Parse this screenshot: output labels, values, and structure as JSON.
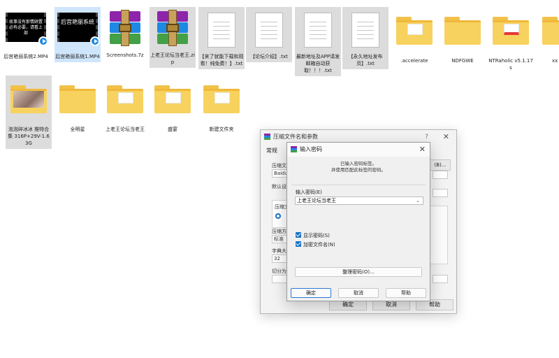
{
  "files": [
    {
      "label": "后宫艳丽系统2.MP4",
      "kind": "video",
      "thumb_text": "故事没有那情顾置\n必有必要，请看上部"
    },
    {
      "label": "后宫艳丽系统1.MP4",
      "kind": "video",
      "thumb_text": "后宫艳丽系统"
    },
    {
      "label": "Screenshots.7z",
      "kind": "rar"
    },
    {
      "label": "上老王论坛当老王.zip",
      "kind": "rar"
    },
    {
      "label": "【来了就能下载和观看！纯免费！】.txt",
      "kind": "doc"
    },
    {
      "label": "【论坛介绍】.txt",
      "kind": "doc"
    },
    {
      "label": "最新地址及APP请发邮箱自动获取！！！.txt",
      "kind": "doc"
    },
    {
      "label": "【永久地址发布页】.txt",
      "kind": "doc"
    },
    {
      "label": ".accelerate",
      "kind": "folder-paper"
    },
    {
      "label": "NDFGWE",
      "kind": "folder"
    },
    {
      "label": "NTRaholic v5.1.17s",
      "kind": "folder-red"
    },
    {
      "label": "xx",
      "kind": "folder"
    },
    {
      "label": "泡泡碎冰冰 推特合集 316P+29V-1.63G",
      "kind": "folder-photo"
    },
    {
      "label": "全明星",
      "kind": "folder"
    },
    {
      "label": "上老王论坛当老王",
      "kind": "folder-paper"
    },
    {
      "label": "盛宴",
      "kind": "folder-paper"
    },
    {
      "label": "新建文件夹",
      "kind": "folder-paper"
    }
  ],
  "archive_dialog": {
    "title": "压缩文件名和参数",
    "help_glyph": "?",
    "close_glyph": "✕",
    "tab_general": "常规",
    "label_archive_name": "压缩文",
    "field_archive_name": "BaiduN",
    "browse_fragment": "(B)...",
    "label_default": "默认设",
    "label_format": "压缩文",
    "label_method": "压缩方",
    "field_method": "标准",
    "label_dict": "字典大",
    "field_dict": "32",
    "label_split": "切分为",
    "ok_label": "确定",
    "cancel_label": "取消",
    "help_label": "帮助"
  },
  "password_dialog": {
    "title": "输入密码",
    "close_glyph": "✕",
    "info_line1": "已输入密码标签。",
    "info_line2": "并使用匹配此标签的密码。",
    "password_label": "输入密码(E)",
    "password_value": "上老王论坛当老王",
    "dropdown_glyph": "⌄",
    "show_password_label": "显示密码(S)",
    "encrypt_filenames_label": "加密文件名(N)",
    "organize_button": "整理密码(O)...",
    "ok_label": "确定",
    "cancel_label": "取消",
    "help_label": "帮助"
  },
  "colors": {
    "selected_blue": "#cfe5fb",
    "selected_gray": "#dcdcdc",
    "folder_yellow": "#f7d25e",
    "accent_blue": "#1a73c9"
  }
}
